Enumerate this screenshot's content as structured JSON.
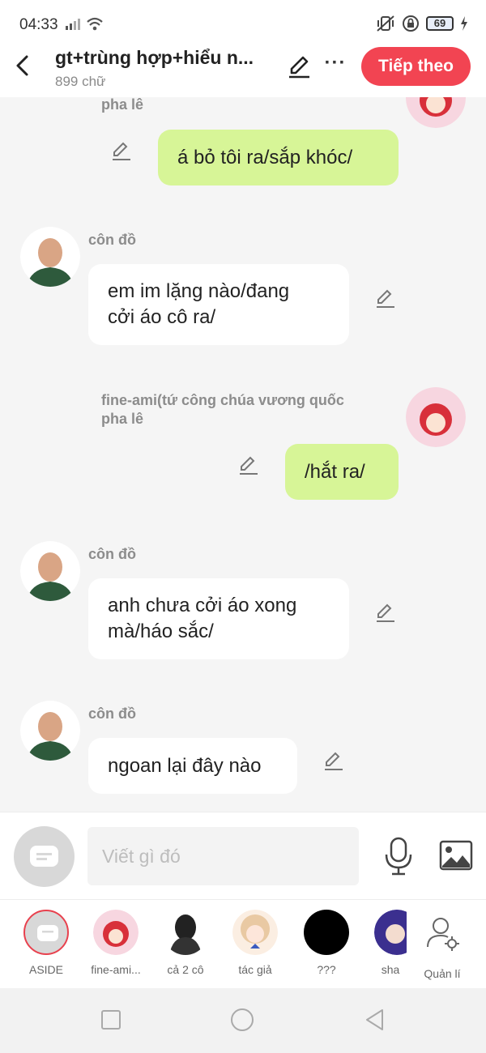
{
  "status_bar": {
    "time": "04:33",
    "battery": "69"
  },
  "header": {
    "title": "gt+trùng hợp+hiểu n...",
    "subtitle": "899 chữ",
    "next_label": "Tiếp theo",
    "more_label": "···"
  },
  "messages": [
    {
      "speaker": "pha lê",
      "text": "á bỏ tôi ra/sắp khóc/"
    },
    {
      "speaker": "côn đồ",
      "line1": "em im lặng nào/đang",
      "line2": "cởi áo cô ra/"
    },
    {
      "speaker_line1": "fine-ami(tứ công chúa vương quốc",
      "speaker_line2": "pha lê",
      "text": "/hắt ra/"
    },
    {
      "speaker": "côn đồ",
      "line1": "anh chưa cởi áo xong",
      "line2": "mà/háo sắc/"
    },
    {
      "speaker": "côn đồ",
      "text": "ngoan lại đây nào"
    }
  ],
  "input": {
    "placeholder": "Viết gì đó"
  },
  "characters": [
    {
      "label": "ASIDE"
    },
    {
      "label": "fine-ami..."
    },
    {
      "label": "cả 2 cô"
    },
    {
      "label": "tác giả"
    },
    {
      "label": "???"
    },
    {
      "label": "sha"
    },
    {
      "label": "Quản lí"
    }
  ],
  "colors": {
    "accent": "#f24452",
    "green_bubble": "#d7f597",
    "white_bubble": "#ffffff",
    "background": "#f5f5f5"
  }
}
